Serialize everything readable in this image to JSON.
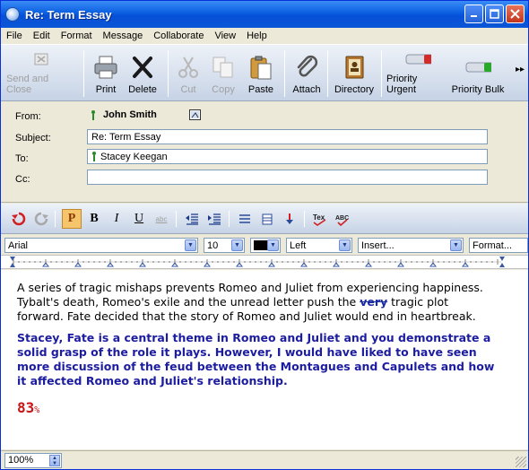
{
  "window": {
    "title": "Re: Term Essay"
  },
  "menu": [
    "File",
    "Edit",
    "Format",
    "Message",
    "Collaborate",
    "View",
    "Help"
  ],
  "toolbar": {
    "send_and_close": "Send and Close",
    "print": "Print",
    "delete": "Delete",
    "cut": "Cut",
    "copy": "Copy",
    "paste": "Paste",
    "attach": "Attach",
    "directory": "Directory",
    "priority_urgent": "Priority Urgent",
    "priority_bulk": "Priority Bulk"
  },
  "header": {
    "from_label": "From:",
    "from_value": "John Smith",
    "subject_label": "Subject:",
    "subject_value": "Re: Term Essay",
    "to_label": "To:",
    "to_value": "Stacey Keegan",
    "cc_label": "Cc:",
    "cc_value": ""
  },
  "format": {
    "font": "Arial",
    "size": "10",
    "align": "Left",
    "insert": "Insert...",
    "format": "Format..."
  },
  "body": {
    "para_before": "A series of tragic mishaps prevents Romeo and Juliet from experiencing happiness. Tybalt's death, Romeo's exile and the unread letter push the ",
    "struck_word": "very",
    "para_after": " tragic plot forward. Fate decided that the story of Romeo and Juliet would end in heartbreak.",
    "comment": "Stacey, Fate is a central theme in Romeo and Juliet and you demonstrate a solid grasp of the role it plays. However, I would have liked to have seen more discussion of the feud between the Montagues and Capulets and how it affected Romeo and Juliet's relationship.",
    "grade": "83",
    "grade_unit": "%"
  },
  "status": {
    "zoom": "100%"
  },
  "colors": {
    "comment": "#1c1ca0",
    "grade": "#c81414",
    "font_color": "#000000"
  }
}
